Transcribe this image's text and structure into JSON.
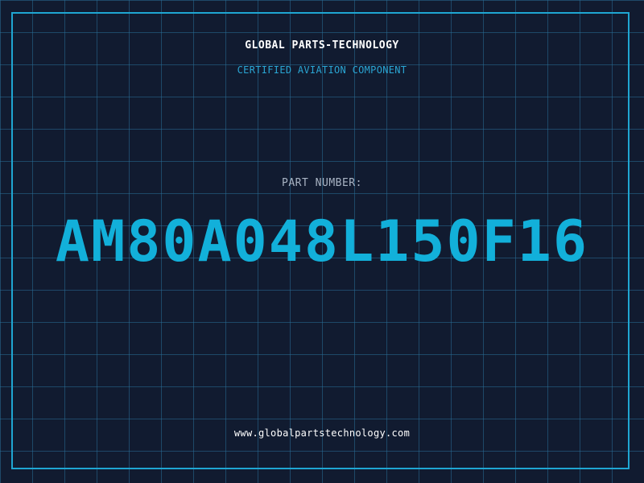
{
  "header": {
    "brand": "GLOBAL PARTS-TECHNOLOGY",
    "tagline": "CERTIFIED AVIATION COMPONENT"
  },
  "part": {
    "label": "PART NUMBER:",
    "number": "AM80A048L150F16"
  },
  "footer": {
    "website": "www.globalpartstechnology.com"
  },
  "colors": {
    "background": "#111b30",
    "grid": "#286e96",
    "accent": "#12b0da",
    "frame": "#1fa6d2",
    "label": "#a9b4c4",
    "text": "#ffffff"
  }
}
